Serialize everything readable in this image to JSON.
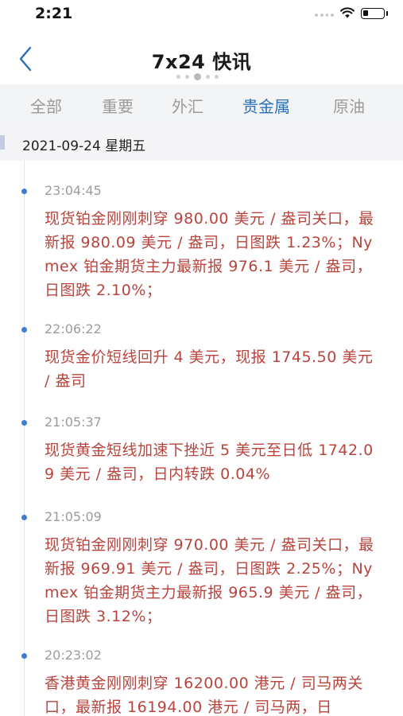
{
  "status": {
    "time": "2:21"
  },
  "nav": {
    "title": "7x24 快讯",
    "back_icon": "chevron-left-icon"
  },
  "tabs": [
    {
      "label": "全部",
      "active": false
    },
    {
      "label": "重要",
      "active": false
    },
    {
      "label": "外汇",
      "active": false
    },
    {
      "label": "贵金属",
      "active": true
    },
    {
      "label": "原油",
      "active": false
    }
  ],
  "date_header": "2021-09-24 星期五",
  "colors": {
    "accent": "#2a6fb8",
    "news_text": "#b8443e",
    "dot": "#3d7bd8"
  },
  "news": [
    {
      "time": "23:04:45",
      "text": "现货铂金刚刚刺穿 980.00 美元 / 盎司关口，最新报 980.09 美元 / 盎司，日图跌 1.23%；Nymex 铂金期货主力最新报 976.1 美元 / 盎司，日图跌 2.10%；"
    },
    {
      "time": "22:06:22",
      "text": "现货金价短线回升 4 美元，现报 1745.50 美元 / 盎司"
    },
    {
      "time": "21:05:37",
      "text": "现货黄金短线加速下挫近 5 美元至日低 1742.09 美元 / 盎司，日内转跌 0.04%"
    },
    {
      "time": "21:05:09",
      "text": "现货铂金刚刚刺穿 970.00 美元 / 盎司关口，最新报 969.91 美元 / 盎司，日图跌 2.25%；Nymex 铂金期货主力最新报 965.9 美元 / 盎司，日图跌 3.12%；"
    },
    {
      "time": "20:23:02",
      "text": "香港黄金刚刚刺穿 16200.00 港元 / 司马两关口，最新报 16194.00 港元 / 司马两，日"
    }
  ]
}
